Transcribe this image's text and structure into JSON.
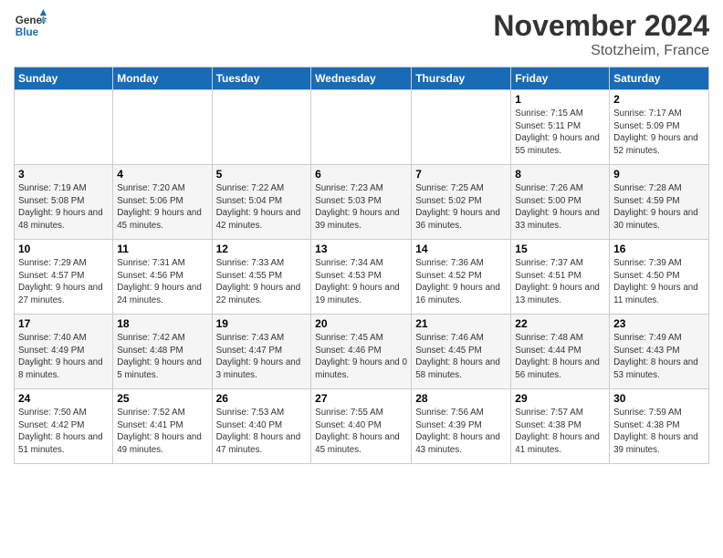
{
  "logo": {
    "line1": "General",
    "line2": "Blue"
  },
  "title": "November 2024",
  "location": "Stotzheim, France",
  "days_header": [
    "Sunday",
    "Monday",
    "Tuesday",
    "Wednesday",
    "Thursday",
    "Friday",
    "Saturday"
  ],
  "weeks": [
    [
      {
        "day": "",
        "sunrise": "",
        "sunset": "",
        "daylight": ""
      },
      {
        "day": "",
        "sunrise": "",
        "sunset": "",
        "daylight": ""
      },
      {
        "day": "",
        "sunrise": "",
        "sunset": "",
        "daylight": ""
      },
      {
        "day": "",
        "sunrise": "",
        "sunset": "",
        "daylight": ""
      },
      {
        "day": "",
        "sunrise": "",
        "sunset": "",
        "daylight": ""
      },
      {
        "day": "1",
        "sunrise": "Sunrise: 7:15 AM",
        "sunset": "Sunset: 5:11 PM",
        "daylight": "Daylight: 9 hours and 55 minutes."
      },
      {
        "day": "2",
        "sunrise": "Sunrise: 7:17 AM",
        "sunset": "Sunset: 5:09 PM",
        "daylight": "Daylight: 9 hours and 52 minutes."
      }
    ],
    [
      {
        "day": "3",
        "sunrise": "Sunrise: 7:19 AM",
        "sunset": "Sunset: 5:08 PM",
        "daylight": "Daylight: 9 hours and 48 minutes."
      },
      {
        "day": "4",
        "sunrise": "Sunrise: 7:20 AM",
        "sunset": "Sunset: 5:06 PM",
        "daylight": "Daylight: 9 hours and 45 minutes."
      },
      {
        "day": "5",
        "sunrise": "Sunrise: 7:22 AM",
        "sunset": "Sunset: 5:04 PM",
        "daylight": "Daylight: 9 hours and 42 minutes."
      },
      {
        "day": "6",
        "sunrise": "Sunrise: 7:23 AM",
        "sunset": "Sunset: 5:03 PM",
        "daylight": "Daylight: 9 hours and 39 minutes."
      },
      {
        "day": "7",
        "sunrise": "Sunrise: 7:25 AM",
        "sunset": "Sunset: 5:02 PM",
        "daylight": "Daylight: 9 hours and 36 minutes."
      },
      {
        "day": "8",
        "sunrise": "Sunrise: 7:26 AM",
        "sunset": "Sunset: 5:00 PM",
        "daylight": "Daylight: 9 hours and 33 minutes."
      },
      {
        "day": "9",
        "sunrise": "Sunrise: 7:28 AM",
        "sunset": "Sunset: 4:59 PM",
        "daylight": "Daylight: 9 hours and 30 minutes."
      }
    ],
    [
      {
        "day": "10",
        "sunrise": "Sunrise: 7:29 AM",
        "sunset": "Sunset: 4:57 PM",
        "daylight": "Daylight: 9 hours and 27 minutes."
      },
      {
        "day": "11",
        "sunrise": "Sunrise: 7:31 AM",
        "sunset": "Sunset: 4:56 PM",
        "daylight": "Daylight: 9 hours and 24 minutes."
      },
      {
        "day": "12",
        "sunrise": "Sunrise: 7:33 AM",
        "sunset": "Sunset: 4:55 PM",
        "daylight": "Daylight: 9 hours and 22 minutes."
      },
      {
        "day": "13",
        "sunrise": "Sunrise: 7:34 AM",
        "sunset": "Sunset: 4:53 PM",
        "daylight": "Daylight: 9 hours and 19 minutes."
      },
      {
        "day": "14",
        "sunrise": "Sunrise: 7:36 AM",
        "sunset": "Sunset: 4:52 PM",
        "daylight": "Daylight: 9 hours and 16 minutes."
      },
      {
        "day": "15",
        "sunrise": "Sunrise: 7:37 AM",
        "sunset": "Sunset: 4:51 PM",
        "daylight": "Daylight: 9 hours and 13 minutes."
      },
      {
        "day": "16",
        "sunrise": "Sunrise: 7:39 AM",
        "sunset": "Sunset: 4:50 PM",
        "daylight": "Daylight: 9 hours and 11 minutes."
      }
    ],
    [
      {
        "day": "17",
        "sunrise": "Sunrise: 7:40 AM",
        "sunset": "Sunset: 4:49 PM",
        "daylight": "Daylight: 9 hours and 8 minutes."
      },
      {
        "day": "18",
        "sunrise": "Sunrise: 7:42 AM",
        "sunset": "Sunset: 4:48 PM",
        "daylight": "Daylight: 9 hours and 5 minutes."
      },
      {
        "day": "19",
        "sunrise": "Sunrise: 7:43 AM",
        "sunset": "Sunset: 4:47 PM",
        "daylight": "Daylight: 9 hours and 3 minutes."
      },
      {
        "day": "20",
        "sunrise": "Sunrise: 7:45 AM",
        "sunset": "Sunset: 4:46 PM",
        "daylight": "Daylight: 9 hours and 0 minutes."
      },
      {
        "day": "21",
        "sunrise": "Sunrise: 7:46 AM",
        "sunset": "Sunset: 4:45 PM",
        "daylight": "Daylight: 8 hours and 58 minutes."
      },
      {
        "day": "22",
        "sunrise": "Sunrise: 7:48 AM",
        "sunset": "Sunset: 4:44 PM",
        "daylight": "Daylight: 8 hours and 56 minutes."
      },
      {
        "day": "23",
        "sunrise": "Sunrise: 7:49 AM",
        "sunset": "Sunset: 4:43 PM",
        "daylight": "Daylight: 8 hours and 53 minutes."
      }
    ],
    [
      {
        "day": "24",
        "sunrise": "Sunrise: 7:50 AM",
        "sunset": "Sunset: 4:42 PM",
        "daylight": "Daylight: 8 hours and 51 minutes."
      },
      {
        "day": "25",
        "sunrise": "Sunrise: 7:52 AM",
        "sunset": "Sunset: 4:41 PM",
        "daylight": "Daylight: 8 hours and 49 minutes."
      },
      {
        "day": "26",
        "sunrise": "Sunrise: 7:53 AM",
        "sunset": "Sunset: 4:40 PM",
        "daylight": "Daylight: 8 hours and 47 minutes."
      },
      {
        "day": "27",
        "sunrise": "Sunrise: 7:55 AM",
        "sunset": "Sunset: 4:40 PM",
        "daylight": "Daylight: 8 hours and 45 minutes."
      },
      {
        "day": "28",
        "sunrise": "Sunrise: 7:56 AM",
        "sunset": "Sunset: 4:39 PM",
        "daylight": "Daylight: 8 hours and 43 minutes."
      },
      {
        "day": "29",
        "sunrise": "Sunrise: 7:57 AM",
        "sunset": "Sunset: 4:38 PM",
        "daylight": "Daylight: 8 hours and 41 minutes."
      },
      {
        "day": "30",
        "sunrise": "Sunrise: 7:59 AM",
        "sunset": "Sunset: 4:38 PM",
        "daylight": "Daylight: 8 hours and 39 minutes."
      }
    ]
  ]
}
